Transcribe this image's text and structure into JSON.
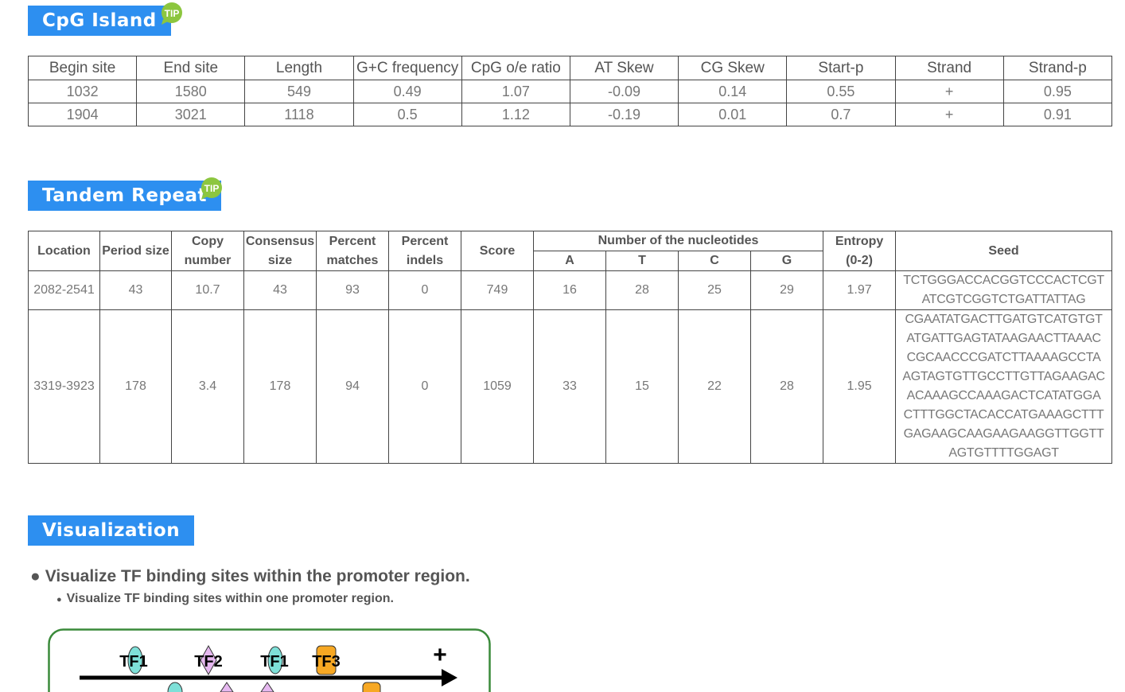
{
  "cpg": {
    "title": "CpG Island",
    "tip": "TIP",
    "headers": [
      "Begin site",
      "End site",
      "Length",
      "G+C frequency",
      "CpG o/e ratio",
      "AT Skew",
      "CG Skew",
      "Start-p",
      "Strand",
      "Strand-p"
    ],
    "rows": [
      [
        "1032",
        "1580",
        "549",
        "0.49",
        "1.07",
        "-0.09",
        "0.14",
        "0.55",
        "+",
        "0.95"
      ],
      [
        "1904",
        "3021",
        "1118",
        "0.5",
        "1.12",
        "-0.19",
        "0.01",
        "0.7",
        "+",
        "0.91"
      ]
    ]
  },
  "tandem": {
    "title": "Tandem Repeat",
    "tip": "TIP",
    "headers": {
      "location": "Location",
      "period": "Period size",
      "copy": [
        "Copy",
        "number"
      ],
      "consensus": [
        "Consensus",
        "size"
      ],
      "matches": [
        "Percent",
        "matches"
      ],
      "indels": [
        "Percent",
        "indels"
      ],
      "score": "Score",
      "nucleotides": "Number of the nucleotides",
      "a": "A",
      "t": "T",
      "c": "C",
      "g": "G",
      "entropy": [
        "Entropy",
        "(0-2)"
      ],
      "seed": "Seed"
    },
    "rows": [
      {
        "location": "2082-2541",
        "period": "43",
        "copy": "10.7",
        "consensus": "43",
        "matches": "93",
        "indels": "0",
        "score": "749",
        "a": "16",
        "t": "28",
        "c": "25",
        "g": "29",
        "entropy": "1.97",
        "seed": [
          "TCTGGGACCACGGTCCCACTCGT",
          "ATCGTCGGTCTGATTATTAG"
        ]
      },
      {
        "location": "3319-3923",
        "period": "178",
        "copy": "3.4",
        "consensus": "178",
        "matches": "94",
        "indels": "0",
        "score": "1059",
        "a": "33",
        "t": "15",
        "c": "22",
        "g": "28",
        "entropy": "1.95",
        "seed": [
          "CGAATATGACTTGATGTCATGTGT",
          "ATGATTGAGTATAAGAACTTAAAC",
          "CGCAACCCGATCTTAAAAGCCTA",
          "AGTAGTGTTGCCTTGTTAGAAGAC",
          "ACAAAGCCAAAGACTCATATGGA",
          "CTTTGGCTACACCATGAAAGCTTT",
          "GAGAAGCAAGAAGAAGGTTGGTT",
          "AGTGTTTTGGAGT"
        ]
      }
    ]
  },
  "visualization": {
    "title": "Visualization",
    "bullet1": "Visualize TF binding sites within the promoter region.",
    "bullet2": "Visualize TF binding sites within one promoter region.",
    "diagram": {
      "labels": [
        "TF1",
        "TF2",
        "TF1",
        "TF3"
      ],
      "strand": "+",
      "colors": {
        "tf1": "#7ee0d8",
        "tf2": "#e6b8f0",
        "tf3": "#f7a823",
        "border": "#3a8a3a"
      }
    }
  }
}
